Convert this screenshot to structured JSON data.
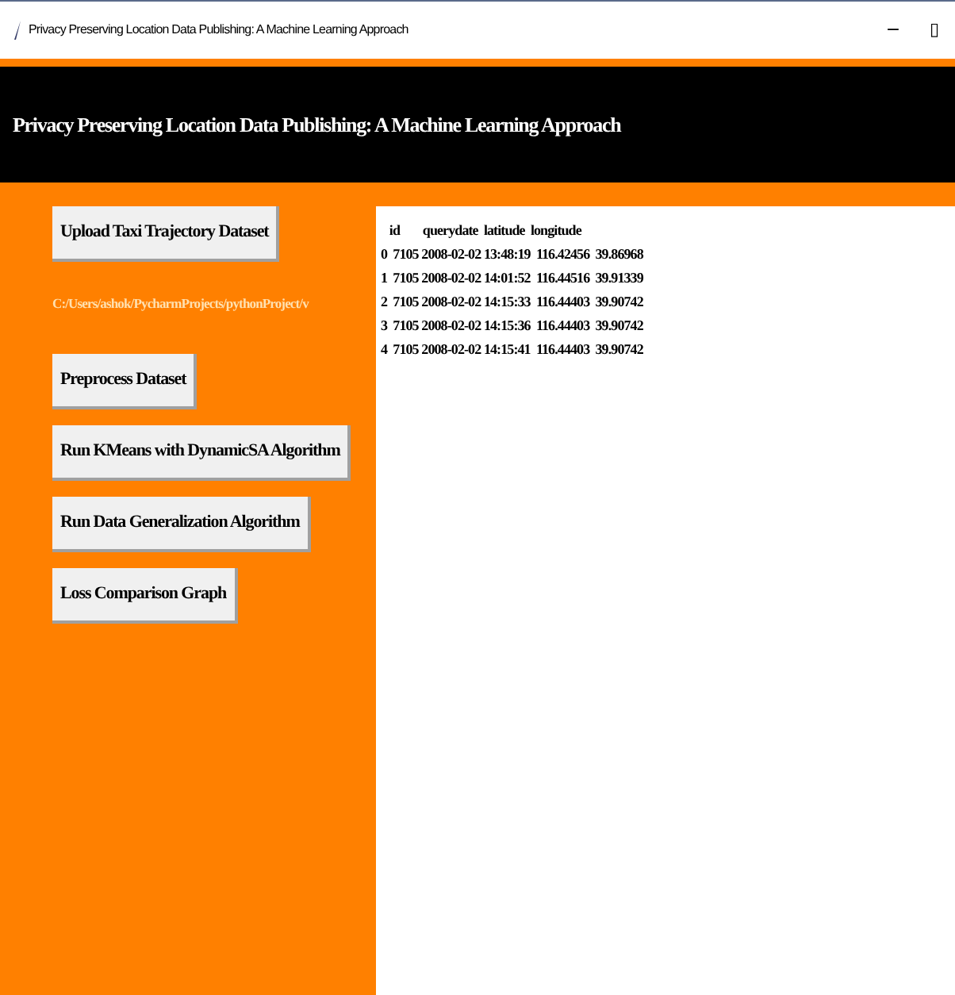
{
  "window": {
    "title": "Privacy Preserving Location Data Publishing: A Machine Learning Approach",
    "controls": [
      "−",
      "▯"
    ]
  },
  "header": {
    "title": "Privacy Preserving Location Data Publishing: A Machine Learning Approach"
  },
  "buttons": [
    {
      "kind": "button",
      "label": "Upload Taxi Trajectory Dataset"
    },
    {
      "kind": "path",
      "label": "C:/Users/ashok/PycharmProjects/pythonProject/v"
    },
    {
      "kind": "button",
      "label": "Preprocess Dataset"
    },
    {
      "kind": "button",
      "label": "Run KMeans with DynamicSA Algorithm"
    },
    {
      "kind": "button",
      "label": "Run Data Generalization Algorithm"
    },
    {
      "kind": "button",
      "label": "Loss Comparison Graph"
    }
  ],
  "output": {
    "lines": [
      "   id        querydate  latitude  longitude",
      "0  7105 2008-02-02 13:48:19  116.42456  39.86968",
      "1  7105 2008-02-02 14:01:52  116.44516  39.91339",
      "2  7105 2008-02-02 14:15:33  116.44403  39.90742",
      "3  7105 2008-02-02 14:15:36  116.44403  39.90742",
      "4  7105 2008-02-02 14:15:41  116.44403  39.90742"
    ]
  }
}
